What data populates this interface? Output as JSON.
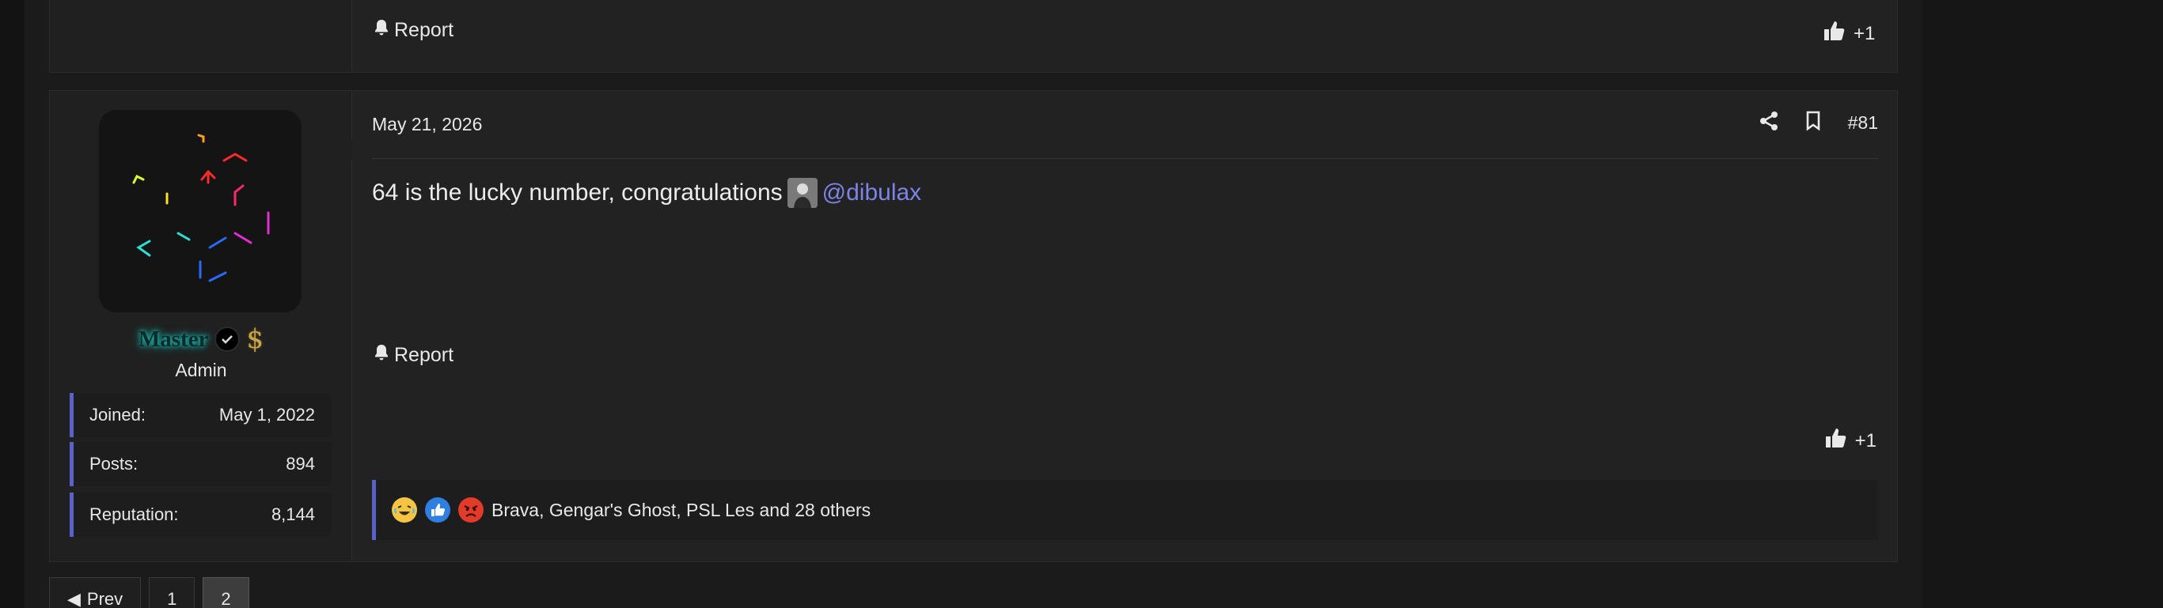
{
  "previous_post": {
    "report_label": "Report",
    "like_label": "+1"
  },
  "post": {
    "date": "May 21, 2026",
    "post_number": "#81",
    "body_text": "64 is the lucky number, congratulations",
    "mention": "@dibulax",
    "report_label": "Report",
    "like_label": "+1",
    "reactions_text": "Brava, Gengar's Ghost, PSL Les and 28 others",
    "reaction_icons": [
      "laughing-emoji-icon",
      "like-emoji-icon",
      "angry-emoji-icon"
    ]
  },
  "author": {
    "username": "Master",
    "role": "Admin",
    "badges": [
      "verified-icon",
      "dollar-icon"
    ],
    "stats": [
      {
        "label": "Joined:",
        "value": "May 1, 2022"
      },
      {
        "label": "Posts:",
        "value": "894"
      },
      {
        "label": "Reputation:",
        "value": "8,144"
      }
    ]
  },
  "pagination": {
    "prev_label": "Prev",
    "pages": [
      "1",
      "2"
    ],
    "current_page": "2"
  },
  "colors": {
    "accent": "#5a62c9",
    "mention": "#7c84e6",
    "background": "#1b1b1b",
    "post_background": "#222222"
  }
}
